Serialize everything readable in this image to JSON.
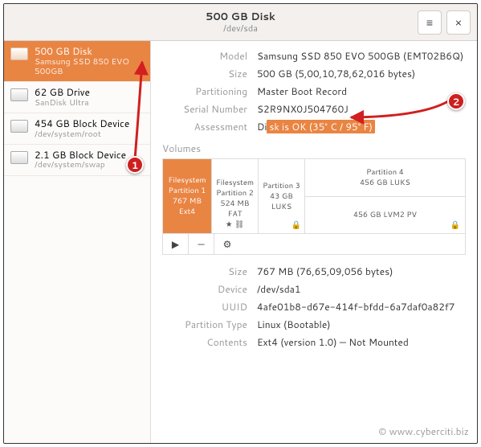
{
  "header": {
    "title": "500 GB Disk",
    "subtitle": "/dev/sda"
  },
  "sidebar": {
    "drives": [
      {
        "name": "500 GB Disk",
        "sub": "Samsung SSD 850 EVO 500GB"
      },
      {
        "name": "62 GB Drive",
        "sub": "SanDisk Ultra"
      },
      {
        "name": "454 GB Block Device",
        "sub": "/dev/system/root"
      },
      {
        "name": "2.1 GB Block Device",
        "sub": "/dev/system/swap"
      }
    ]
  },
  "info": {
    "model_k": "Model",
    "model_v": "Samsung SSD 850 EVO 500GB (EMT02B6Q)",
    "size_k": "Size",
    "size_v": "500 GB (5,00,10,78,62,016 bytes)",
    "part_k": "Partitioning",
    "part_v": "Master Boot Record",
    "serial_k": "Serial Number",
    "serial_v": "S2R9NX0J504760J",
    "assess_k": "Assessment",
    "assess_pre": "Di",
    "assess_hl": "sk is OK (35° C / 95° F)"
  },
  "volumes": {
    "title": "Volumes",
    "p1a": "Filesystem",
    "p1b": "Partition 1",
    "p1c": "767 MB Ext4",
    "p2a": "Filesystem",
    "p2b": "Partition 2",
    "p2c": "524 MB FAT",
    "p3a": "Partition 3",
    "p3b": "43 GB LUKS",
    "p4a": "Partition 4",
    "p4b": "456 GB LUKS",
    "p5a": "456 GB LVM2 PV",
    "star": "★",
    "chain": "⛓",
    "lock": "🔒"
  },
  "toolbar": {
    "play": "▶",
    "minus": "—",
    "gear": "⚙"
  },
  "detail": {
    "size_k": "Size",
    "size_v": "767 MB (76,65,09,056 bytes)",
    "dev_k": "Device",
    "dev_v": "/dev/sda1",
    "uuid_k": "UUID",
    "uuid_v": "4afe01b8-d67e-414f-bfdd-6a7daf0a82f7",
    "pt_k": "Partition Type",
    "pt_v": "Linux (Bootable)",
    "cont_k": "Contents",
    "cont_v": "Ext4 (version 1.0) — Not Mounted"
  },
  "watermark": "© www.cyberciti.biz",
  "anno": {
    "n1": "1",
    "n2": "2"
  }
}
